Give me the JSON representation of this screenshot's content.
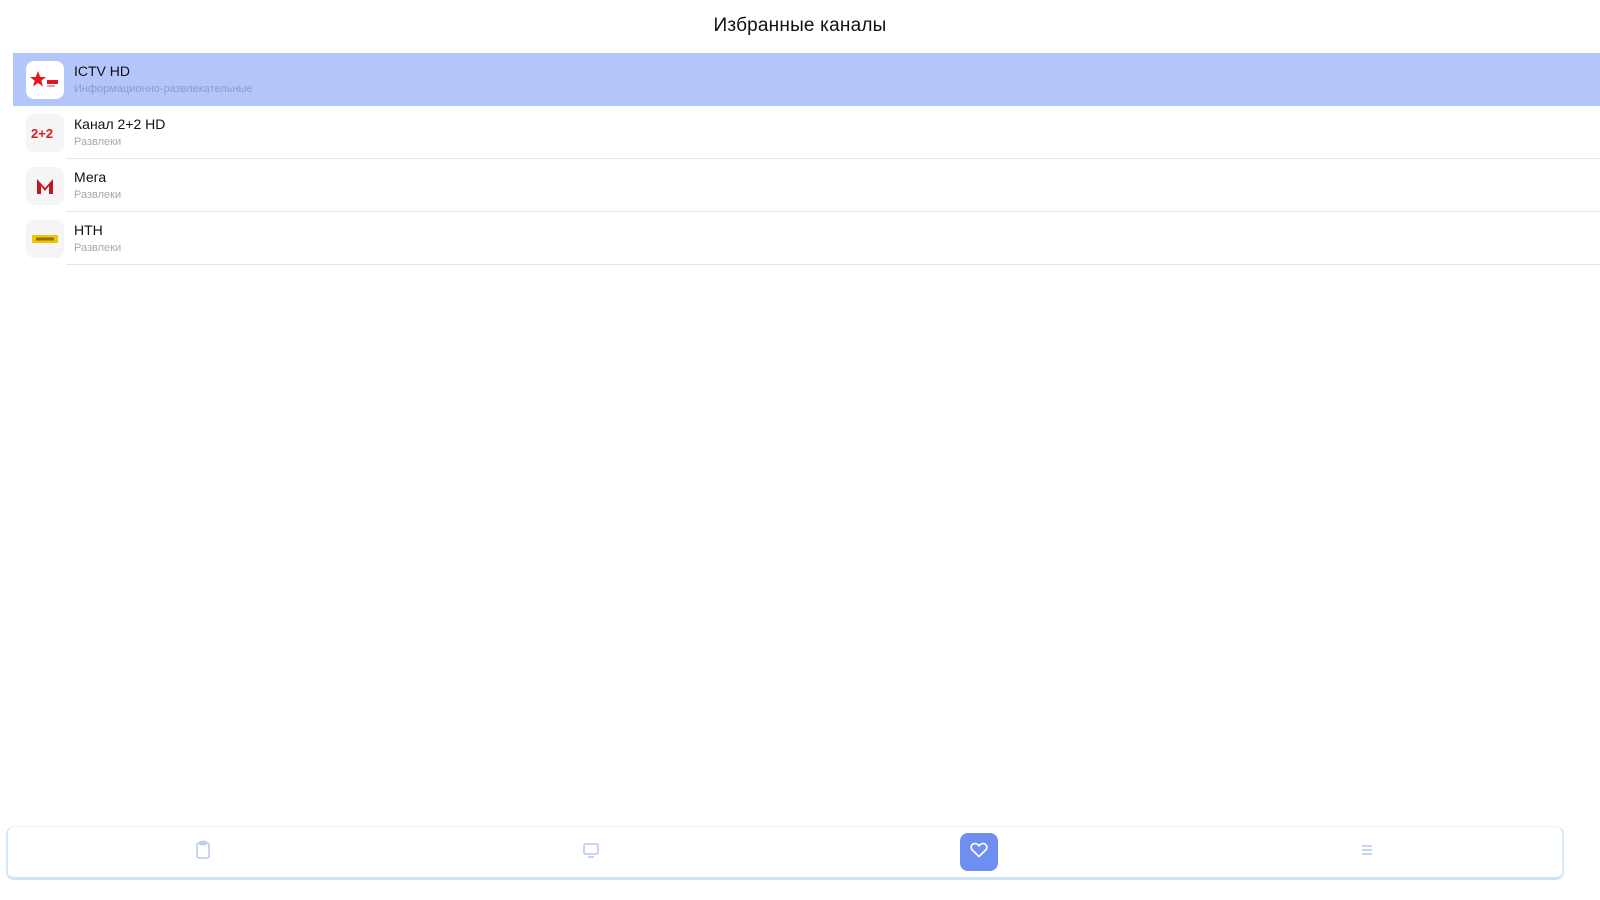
{
  "header": {
    "title": "Избранные каналы"
  },
  "channels": [
    {
      "name": "ICTV HD",
      "genre": "Информационно-развлекательные",
      "icon": "ictv-logo",
      "selected": true
    },
    {
      "name": "Канал 2+2 HD",
      "genre": "Развлеки",
      "icon": "2plus2-logo",
      "selected": false
    },
    {
      "name": "Мега",
      "genre": "Развлеки",
      "icon": "mega-logo",
      "selected": false
    },
    {
      "name": "НТН",
      "genre": "Развлеки",
      "icon": "ntn-logo",
      "selected": false
    }
  ],
  "bottom_nav": {
    "items": [
      {
        "icon": "clipboard-icon",
        "active": false
      },
      {
        "icon": "tv-icon",
        "active": false
      },
      {
        "icon": "heart-icon",
        "active": true
      },
      {
        "icon": "menu-icon",
        "active": false
      }
    ],
    "active_color": "#6f8ff0",
    "icon_color": "#b9c8f0"
  },
  "colors": {
    "selected_row": "#b3c6fb"
  }
}
